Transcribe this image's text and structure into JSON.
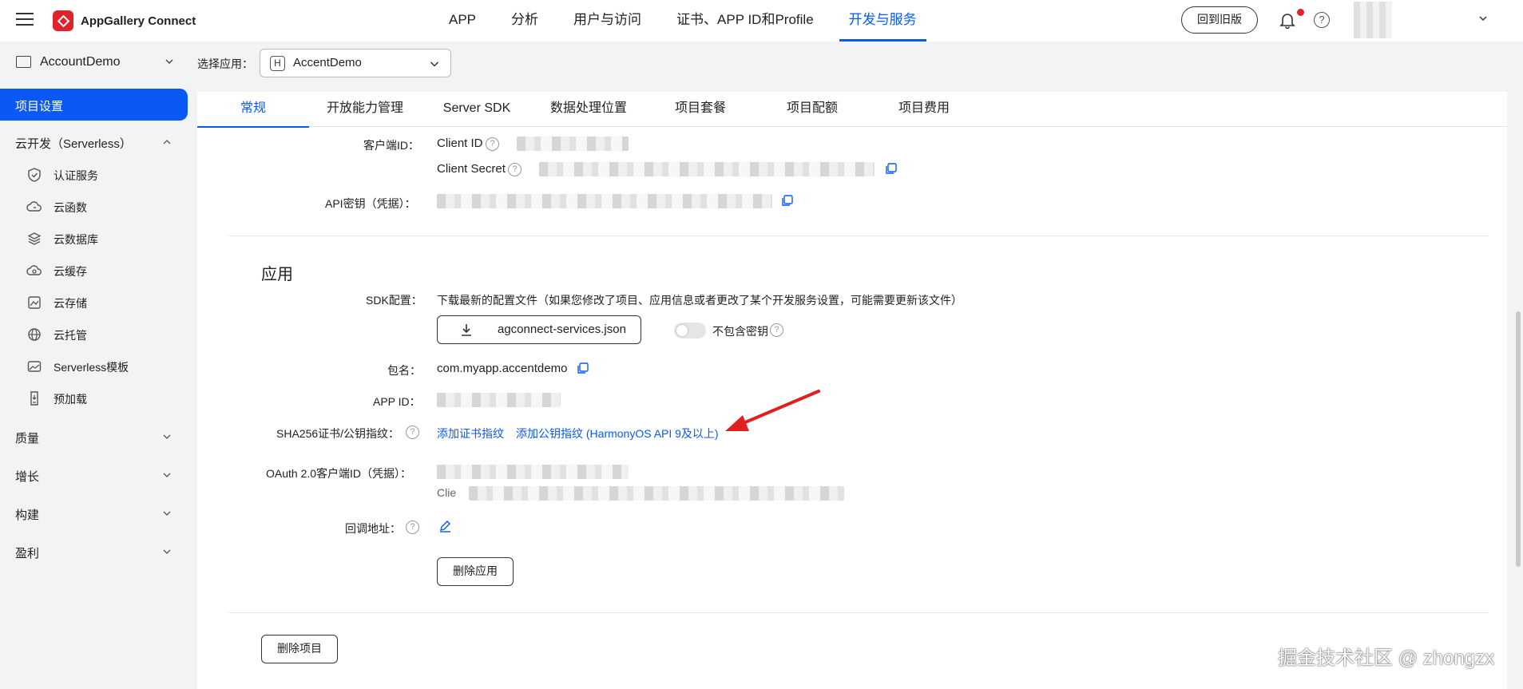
{
  "header": {
    "brand": "AppGallery Connect",
    "nav": [
      "APP",
      "分析",
      "用户与访问",
      "证书、APP ID和Profile",
      "开发与服务"
    ],
    "active_nav": "开发与服务",
    "back_old": "回到旧版"
  },
  "sidebar": {
    "project": "AccountDemo",
    "active_item": "项目设置",
    "cloud_group": "云开发（Serverless）",
    "sub_items": [
      {
        "label": "认证服务",
        "icon": "shield-check-icon"
      },
      {
        "label": "云函数",
        "icon": "cloud-function-icon"
      },
      {
        "label": "云数据库",
        "icon": "database-icon"
      },
      {
        "label": "云缓存",
        "icon": "cloud-cache-icon"
      },
      {
        "label": "云存储",
        "icon": "storage-icon"
      },
      {
        "label": "云托管",
        "icon": "globe-icon"
      },
      {
        "label": "Serverless模板",
        "icon": "template-icon"
      },
      {
        "label": "预加载",
        "icon": "preload-icon"
      }
    ],
    "groups": [
      "质量",
      "增长",
      "构建",
      "盈利"
    ]
  },
  "app_select": {
    "label": "选择应用：",
    "badge": "H",
    "value": "AccentDemo"
  },
  "tabs": [
    "常规",
    "开放能力管理",
    "Server SDK",
    "数据处理位置",
    "项目套餐",
    "项目配额",
    "项目费用"
  ],
  "active_tab": "常规",
  "project_info": {
    "client_id_label": "客户端ID：",
    "client_id_key": "Client ID",
    "client_secret_key": "Client Secret",
    "api_key_label": "API密钥（凭据）："
  },
  "app_section": {
    "title": "应用",
    "sdk_label": "SDK配置：",
    "sdk_desc": "下载最新的配置文件（如果您修改了项目、应用信息或者更改了某个开发服务设置，可能需要更新该文件）",
    "download_btn": "agconnect-services.json",
    "toggle_label": "不包含密钥",
    "toggle_on": false,
    "package_label": "包名：",
    "package_value": "com.myapp.accentdemo",
    "appid_label": "APP ID：",
    "sha_label": "SHA256证书/公钥指纹：",
    "sha_link_cert": "添加证书指纹",
    "sha_link_pubkey": "添加公钥指纹 (HarmonyOS API 9及以上)",
    "oauth_label": "OAuth 2.0客户端ID（凭据）：",
    "oauth_partial": "Clie",
    "callback_label": "回调地址：",
    "delete_app": "删除应用"
  },
  "delete_project": "删除项目",
  "watermark": "掘金技术社区 @ zhongzx",
  "colors": {
    "accent": "#0a59f7",
    "brand": "#e0222b",
    "annotation_arrow": "#e02020"
  }
}
